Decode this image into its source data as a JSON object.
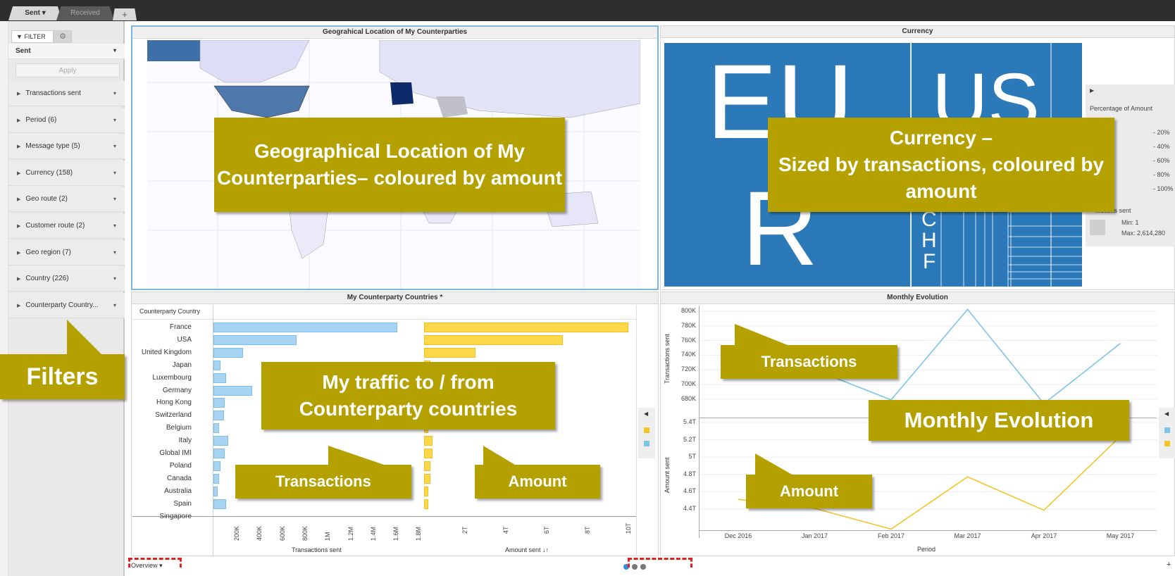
{
  "tabs": {
    "sent": "Sent",
    "received": "Received",
    "add": "+"
  },
  "filter": {
    "header": "FILTER",
    "selected": "Sent",
    "apply": "Apply",
    "items": [
      "Transactions sent",
      "Period (6)",
      "Message type (5)",
      "Currency (158)",
      "Geo route (2)",
      "Customer route (2)",
      "Geo region (7)",
      "Country (226)",
      "Counterparty Country..."
    ]
  },
  "panels": {
    "map": "Geograhical Location of My Counterparties",
    "currency": "Currency",
    "countries": "My Counterparty Countries *",
    "monthly": "Monthly Evolution"
  },
  "currency_tiles": {
    "eur": "EUR",
    "usd": "US",
    "chf": "CHF"
  },
  "legend": {
    "title": "Percentage of Amount",
    "ranges": [
      "- 20%",
      "- 40%",
      "- 60%",
      "- 80%",
      "- 100%"
    ],
    "size_title": "...ctions sent",
    "min": "Min: 1",
    "max": "Max: 2,614,280"
  },
  "countries": {
    "column_header": "Counterparty Country",
    "names": [
      "France",
      "USA",
      "United Kingdom",
      "Japan",
      "Luxembourg",
      "Germany",
      "Hong Kong",
      "Switzerland",
      "Belgium",
      "Italy",
      "Global IMI",
      "Poland",
      "Canada",
      "Australia",
      "Spain",
      "Singapore"
    ],
    "transactions_ticks": [
      "200K",
      "400K",
      "600K",
      "800K",
      "1M",
      "1.2M",
      "1.4M",
      "1.6M",
      "1.8M"
    ],
    "amount_ticks": [
      "2T",
      "4T",
      "6T",
      "8T",
      "10T"
    ],
    "transactions_label": "Transactions sent",
    "amount_label": "Amount sent"
  },
  "chart_data": [
    {
      "type": "bar",
      "title": "My Counterparty Countries *",
      "xlabel": "Transactions sent",
      "categories": [
        "France",
        "USA",
        "United Kingdom",
        "Japan",
        "Luxembourg",
        "Germany",
        "Hong Kong",
        "Switzerland",
        "Belgium",
        "Italy",
        "Global IMI",
        "Poland",
        "Canada",
        "Australia",
        "Spain"
      ],
      "values": [
        1620000,
        730000,
        260000,
        60000,
        110000,
        340000,
        100000,
        90000,
        50000,
        130000,
        100000,
        60000,
        50000,
        40000,
        110000
      ]
    },
    {
      "type": "bar",
      "title": "My Counterparty Countries *",
      "xlabel": "Amount sent",
      "categories": [
        "France",
        "USA",
        "United Kingdom",
        "Japan",
        "Luxembourg",
        "Germany",
        "Hong Kong",
        "Switzerland",
        "Belgium",
        "Italy",
        "Global IMI",
        "Poland",
        "Canada",
        "Australia",
        "Spain"
      ],
      "values": [
        10000000000000,
        6800000000000,
        2500000000000,
        300000000000,
        400000000000,
        400000000000,
        400000000000,
        300000000000,
        200000000000,
        400000000000,
        400000000000,
        300000000000,
        300000000000,
        200000000000,
        200000000000
      ]
    },
    {
      "type": "line",
      "title": "Monthly Evolution",
      "xlabel": "Period",
      "ylabel": "Transactions sent",
      "x": [
        "Dec 2016",
        "Jan 2017",
        "Feb 2017",
        "Mar 2017",
        "Apr 2017",
        "May 2017"
      ],
      "series": [
        {
          "values": [
            758000,
            720000,
            680000,
            800000,
            675000,
            755000
          ]
        }
      ],
      "ylim": [
        665000,
        805000
      ]
    },
    {
      "type": "line",
      "title": "Monthly Evolution",
      "xlabel": "Period",
      "ylabel": "Amount sent",
      "x": [
        "Dec 2016",
        "Jan 2017",
        "Feb 2017",
        "Mar 2017",
        "Apr 2017",
        "May 2017"
      ],
      "series": [
        {
          "values": [
            4600000000000,
            4500000000000,
            4270000000000,
            4850000000000,
            4480000000000,
            5300000000000
          ]
        }
      ],
      "ylim": [
        4250000000000,
        5500000000000
      ]
    }
  ],
  "monthly": {
    "ytrans": [
      "800K",
      "780K",
      "760K",
      "740K",
      "720K",
      "700K",
      "680K"
    ],
    "yamt": [
      "5.4T",
      "5.2T",
      "5T",
      "4.8T",
      "4.6T",
      "4.4T"
    ],
    "months": [
      "Dec 2016",
      "Jan 2017",
      "Feb 2017",
      "Mar 2017",
      "Apr 2017",
      "May 2017"
    ],
    "xlabel": "Period",
    "ylabel_trans": "Transactions sent",
    "ylabel_amt": "Amount sent"
  },
  "callouts": {
    "map": "Geographical Location of My Counterparties– coloured by amount",
    "currency": "Currency –\nSized by transactions, coloured by amount",
    "traffic": "My traffic to / from Counterparty countries",
    "transactions": "Transactions",
    "amount": "Amount",
    "monthly": "Monthly Evolution",
    "trans2": "Transactions",
    "amount2": "Amount",
    "filters": "Filters"
  },
  "footer": {
    "page": "Overview",
    "plus": "+"
  },
  "colors": {
    "accent": "#b4a100",
    "tile": "#2b79b8",
    "trans": "#7dc4ea",
    "amount": "#f4c528"
  }
}
